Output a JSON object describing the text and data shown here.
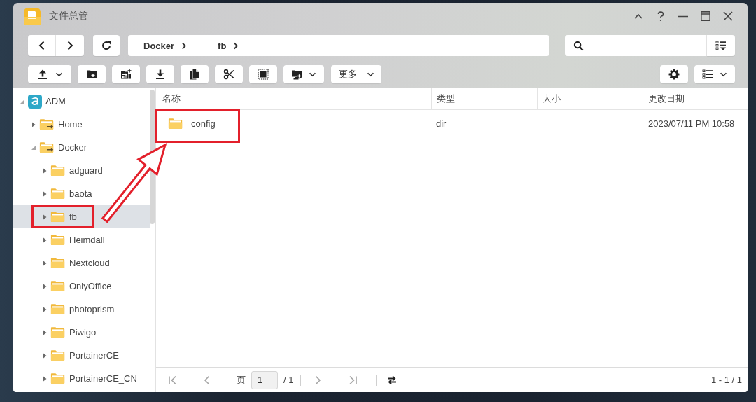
{
  "window": {
    "title": "文件总管"
  },
  "breadcrumbs": [
    {
      "label": "Docker"
    },
    {
      "label": "fb"
    }
  ],
  "toolbar": {
    "more_label": "更多"
  },
  "sidebar": {
    "tree": [
      {
        "label": "ADM",
        "kind": "volume",
        "expanded": true,
        "selected": false,
        "highlighted": false,
        "children": [
          {
            "label": "Home",
            "kind": "shared",
            "expanded": false,
            "selected": false,
            "highlighted": false
          },
          {
            "label": "Docker",
            "kind": "shared",
            "expanded": true,
            "selected": false,
            "highlighted": false,
            "children": [
              {
                "label": "adguard",
                "kind": "folder",
                "expanded": false,
                "selected": false,
                "highlighted": false
              },
              {
                "label": "baota",
                "kind": "folder",
                "expanded": false,
                "selected": false,
                "highlighted": false
              },
              {
                "label": "fb",
                "kind": "folder",
                "expanded": false,
                "selected": true,
                "highlighted": true
              },
              {
                "label": "Heimdall",
                "kind": "folder",
                "expanded": false,
                "selected": false,
                "highlighted": false
              },
              {
                "label": "Nextcloud",
                "kind": "folder",
                "expanded": false,
                "selected": false,
                "highlighted": false
              },
              {
                "label": "OnlyOffice",
                "kind": "folder",
                "expanded": false,
                "selected": false,
                "highlighted": false
              },
              {
                "label": "photoprism",
                "kind": "folder",
                "expanded": false,
                "selected": false,
                "highlighted": false
              },
              {
                "label": "Piwigo",
                "kind": "folder",
                "expanded": false,
                "selected": false,
                "highlighted": false
              },
              {
                "label": "PortainerCE",
                "kind": "folder",
                "expanded": false,
                "selected": false,
                "highlighted": false
              },
              {
                "label": "PortainerCE_CN",
                "kind": "folder",
                "expanded": false,
                "selected": false,
                "highlighted": false
              }
            ]
          }
        ]
      }
    ]
  },
  "list": {
    "columns": [
      {
        "label": "名称"
      },
      {
        "label": "类型"
      },
      {
        "label": "大小"
      },
      {
        "label": "更改日期"
      }
    ],
    "rows": [
      {
        "name": "config",
        "kind": "folder",
        "type": "dir",
        "date": "2023/07/11 PM 10:58",
        "selected": false,
        "highlighted": true
      }
    ]
  },
  "pager": {
    "nav_disabled": true,
    "page_label": "页",
    "page": "1",
    "total": "/ 1",
    "range": "1 - 1 / 1"
  }
}
